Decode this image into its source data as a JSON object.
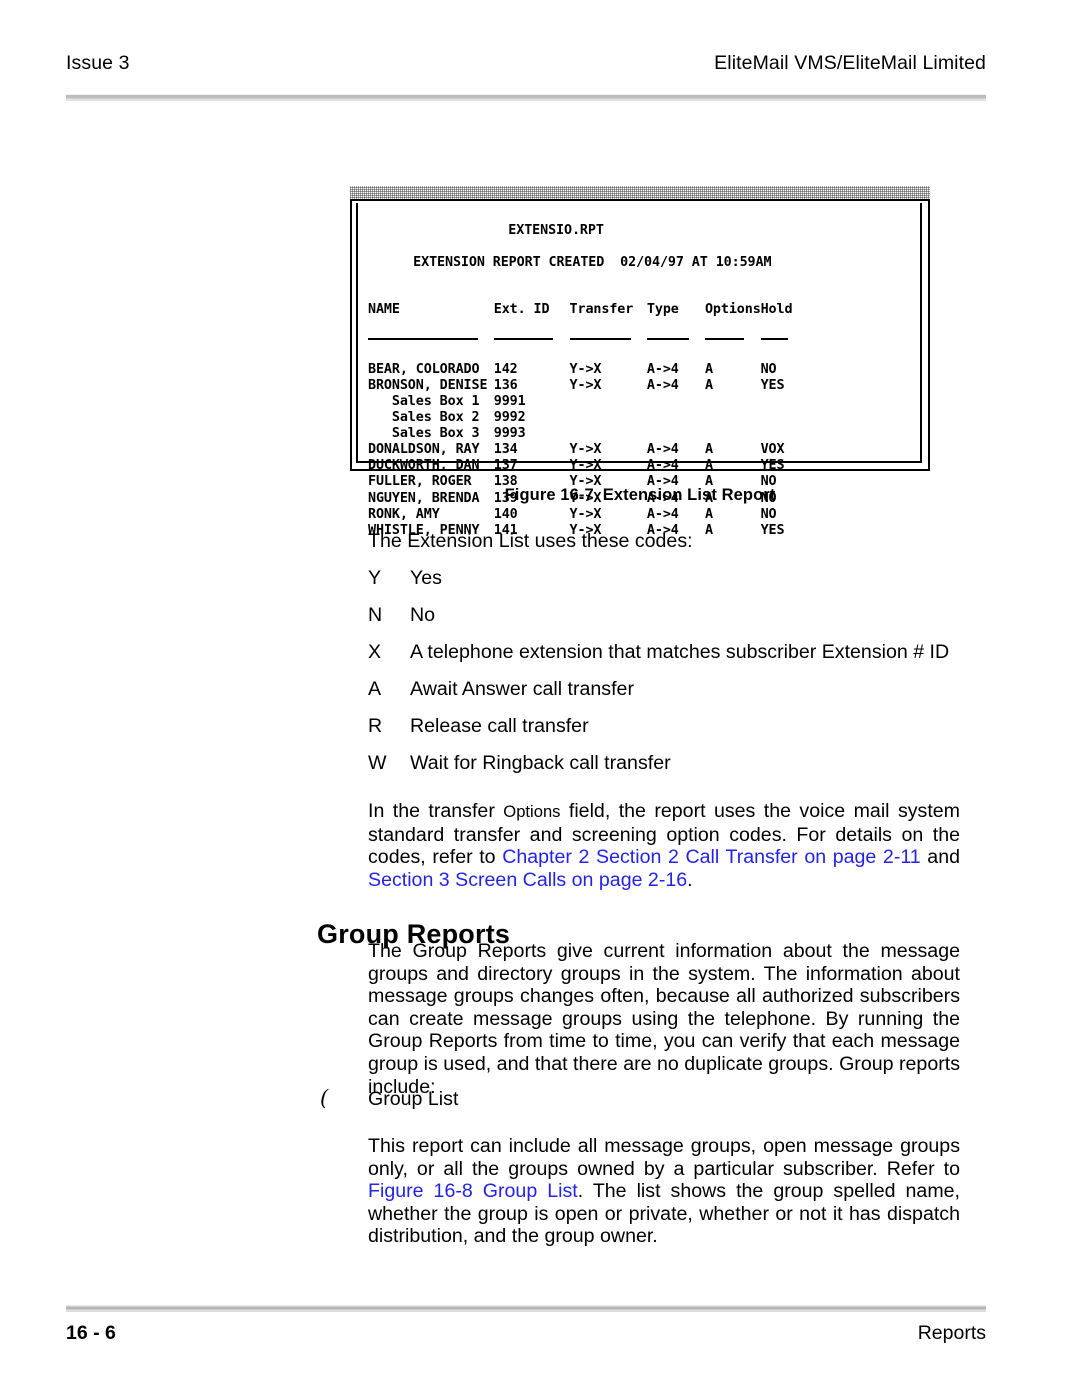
{
  "header": {
    "left": "Issue 3",
    "right": "EliteMail VMS/EliteMail Limited"
  },
  "figure": {
    "report_file": "EXTENSIO.RPT",
    "report_line": "EXTENSION REPORT CREATED  02/04/97 AT 10:59AM",
    "columns": [
      "NAME",
      "Ext. ID",
      "Transfer",
      "Type",
      "Options",
      "Hold"
    ],
    "rows": [
      {
        "name": "BEAR, COLORADO",
        "ext": "142",
        "transfer": "Y->X",
        "type": "A->4",
        "options": "A",
        "hold": "NO"
      },
      {
        "name": "BRONSON, DENISE",
        "ext": "136",
        "transfer": "Y->X",
        "type": "A->4",
        "options": "A",
        "hold": "YES"
      },
      {
        "name": "   Sales Box 1",
        "ext": "9991",
        "transfer": "",
        "type": "",
        "options": "",
        "hold": ""
      },
      {
        "name": "   Sales Box 2",
        "ext": "9992",
        "transfer": "",
        "type": "",
        "options": "",
        "hold": ""
      },
      {
        "name": "   Sales Box 3",
        "ext": "9993",
        "transfer": "",
        "type": "",
        "options": "",
        "hold": ""
      },
      {
        "name": "DONALDSON, RAY",
        "ext": "134",
        "transfer": "Y->X",
        "type": "A->4",
        "options": "A",
        "hold": "VOX"
      },
      {
        "name": "DUCKWORTH, DAN",
        "ext": "137",
        "transfer": "Y->X",
        "type": "A->4",
        "options": "A",
        "hold": "YES"
      },
      {
        "name": "FULLER, ROGER",
        "ext": "138",
        "transfer": "Y->X",
        "type": "A->4",
        "options": "A",
        "hold": "NO"
      },
      {
        "name": "NGUYEN, BRENDA",
        "ext": "139",
        "transfer": "Y->X",
        "type": "A->4",
        "options": "A",
        "hold": "NO"
      },
      {
        "name": "RONK, AMY",
        "ext": "140",
        "transfer": "Y->X",
        "type": "A->4",
        "options": "A",
        "hold": "NO"
      },
      {
        "name": "WHISTLE, PENNY",
        "ext": "141",
        "transfer": "Y->X",
        "type": "A->4",
        "options": "A",
        "hold": "YES"
      }
    ],
    "caption_number": "Figure 16-7",
    "caption_title": "Extension List Report"
  },
  "content": {
    "intro": "The Extension List uses these codes:",
    "codes": [
      {
        "key": "Y",
        "meaning": "Yes"
      },
      {
        "key": "N",
        "meaning": "No"
      },
      {
        "key": "X",
        "meaning": "A telephone extension that matches subscriber Extension # ID"
      },
      {
        "key": "A",
        "meaning": "Await Answer call transfer"
      },
      {
        "key": "R",
        "meaning": "Release call transfer"
      },
      {
        "key": "W",
        "meaning": "Wait for Ringback call transfer"
      }
    ],
    "options_para": {
      "part1": "In the transfer ",
      "options_word": "Options",
      "part2": " field, the report uses the voice mail system standard transfer and screening option codes. For details on the codes, refer to ",
      "link1": "Chapter 2 Section 2 Call Transfer on page 2-11",
      "part3": " and ",
      "link2": "Section 3 Screen Calls on page 2-16",
      "part4": "."
    },
    "section_title": "Group Reports",
    "group_para": "The Group Reports give current information about the message groups and directory groups in the system. The information about message groups changes often, because all authorized subscribers can create message groups using the telephone. By running the Group Reports from time to time, you can verify that each message group is used, and that there are no duplicate groups. Group reports include:",
    "bullet": {
      "marker": "(",
      "label": "Group List"
    },
    "grouplist_para": {
      "part1": "This report can include all message groups, open message groups only, or all the groups owned by a particular subscriber. Refer to ",
      "link": "Figure 16-8 Group List",
      "part2": ". The list shows the group spelled name, whether the group is open or private, whether or not it has dispatch distribution, and the group owner."
    }
  },
  "footer": {
    "left": "16 - 6",
    "right": "Reports"
  },
  "colors": {
    "link": "#2323e6",
    "rule": "#bdbdbd",
    "text": "#000000"
  }
}
